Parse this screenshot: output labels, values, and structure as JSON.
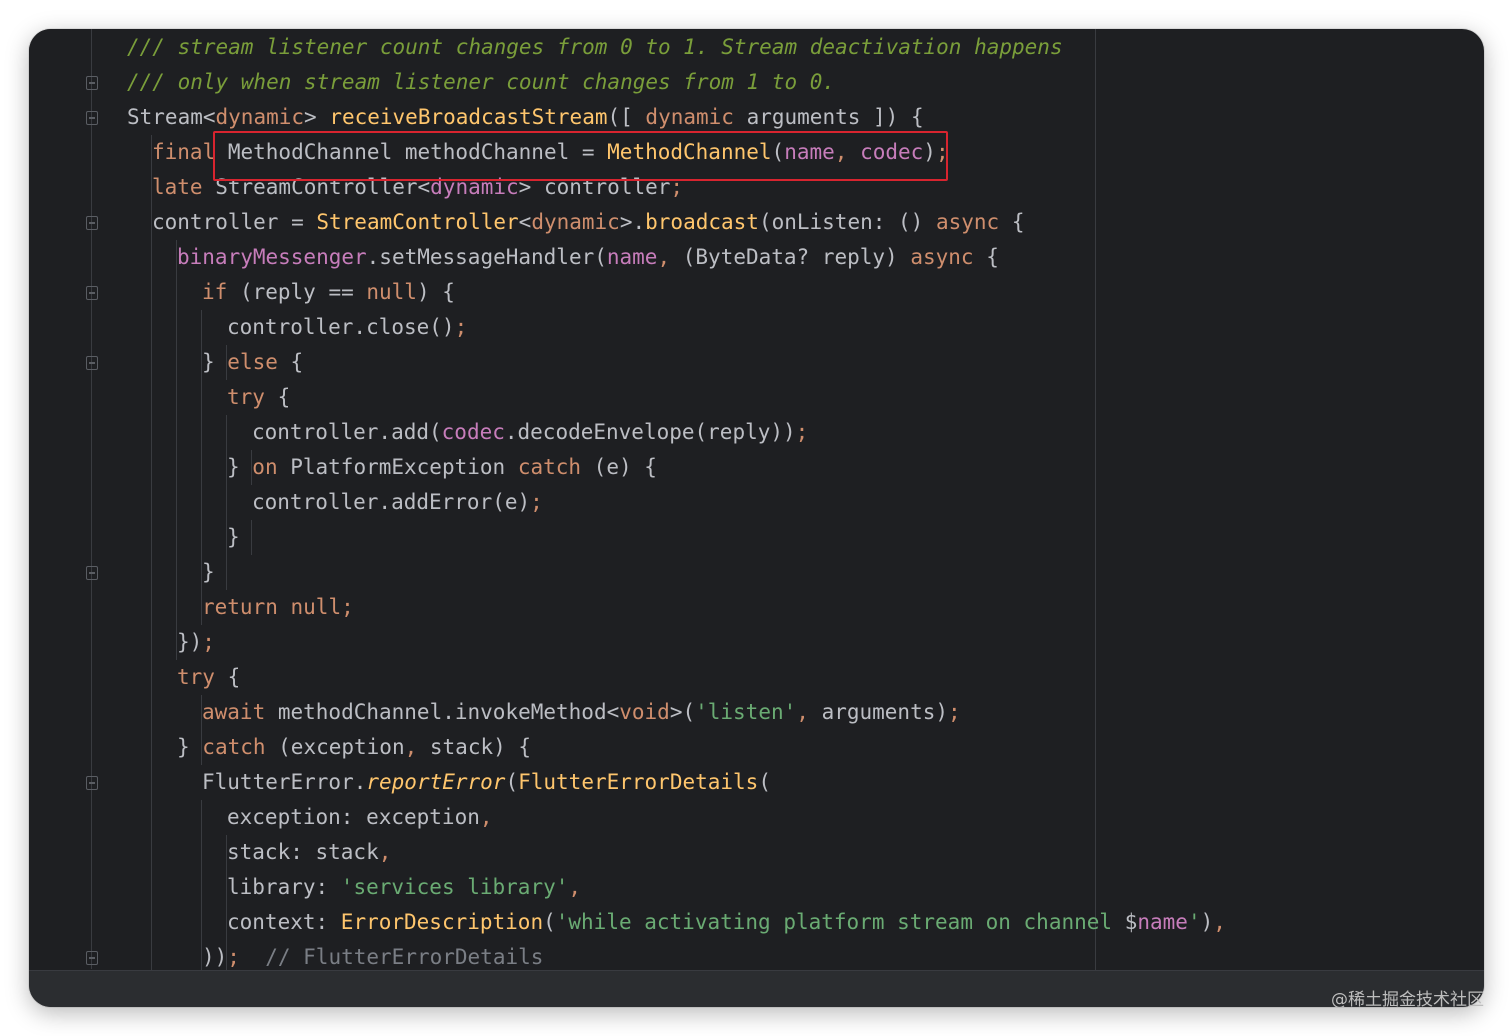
{
  "editor": {
    "language": "Dart",
    "theme_colors": {
      "background": "#1e1f22",
      "comment": "#7a9e3a",
      "keyword": "#cf8e6d",
      "function": "#ffc66d",
      "string": "#6aab73",
      "field": "#c77dbb",
      "text": "#bcbec4",
      "highlight_box": "#d8242f"
    },
    "lines": [
      {
        "indent": 0,
        "tokens": [
          {
            "t": "/// stream listener count changes from 0 to 1. Stream deactivation happens",
            "c": "cmt"
          }
        ]
      },
      {
        "indent": 0,
        "tokens": [
          {
            "t": "/// only when stream listener count changes from 1 to 0.",
            "c": "cmt"
          }
        ]
      },
      {
        "indent": 0,
        "tokens": [
          {
            "t": "Stream<",
            "c": "type"
          },
          {
            "t": "dynamic",
            "c": "kw"
          },
          {
            "t": "> ",
            "c": "type"
          },
          {
            "t": "receiveBroadcastStream",
            "c": "fn"
          },
          {
            "t": "([ ",
            "c": "type"
          },
          {
            "t": "dynamic",
            "c": "kw"
          },
          {
            "t": " arguments ]) {",
            "c": "type"
          }
        ]
      },
      {
        "indent": 1,
        "tokens": [
          {
            "t": "final",
            "c": "kw"
          },
          {
            "t": " MethodChannel methodChannel = ",
            "c": "type"
          },
          {
            "t": "MethodChannel",
            "c": "fn"
          },
          {
            "t": "(",
            "c": "type"
          },
          {
            "t": "name",
            "c": "field"
          },
          {
            "t": ", ",
            "c": "punc"
          },
          {
            "t": "codec",
            "c": "field"
          },
          {
            "t": ")",
            "c": "type"
          },
          {
            "t": ";",
            "c": "punc"
          }
        ]
      },
      {
        "indent": 1,
        "tokens": [
          {
            "t": "late",
            "c": "kw"
          },
          {
            "t": " StreamController<",
            "c": "type"
          },
          {
            "t": "dynamic",
            "c": "field"
          },
          {
            "t": "> controller",
            "c": "type"
          },
          {
            "t": ";",
            "c": "punc"
          }
        ]
      },
      {
        "indent": 1,
        "tokens": [
          {
            "t": "controller = ",
            "c": "type"
          },
          {
            "t": "StreamController",
            "c": "fn"
          },
          {
            "t": "<",
            "c": "type"
          },
          {
            "t": "dynamic",
            "c": "kw"
          },
          {
            "t": ">.",
            "c": "type"
          },
          {
            "t": "broadcast",
            "c": "fn"
          },
          {
            "t": "(onListen: () ",
            "c": "type"
          },
          {
            "t": "async",
            "c": "kw"
          },
          {
            "t": " {",
            "c": "type"
          }
        ]
      },
      {
        "indent": 2,
        "tokens": [
          {
            "t": "binaryMessenger",
            "c": "field"
          },
          {
            "t": ".setMessageHandler(",
            "c": "type"
          },
          {
            "t": "name",
            "c": "field"
          },
          {
            "t": ", ",
            "c": "punc"
          },
          {
            "t": "(ByteData? reply) ",
            "c": "type"
          },
          {
            "t": "async",
            "c": "kw"
          },
          {
            "t": " {",
            "c": "type"
          }
        ]
      },
      {
        "indent": 3,
        "tokens": [
          {
            "t": "if",
            "c": "kw"
          },
          {
            "t": " (reply == ",
            "c": "type"
          },
          {
            "t": "null",
            "c": "kw"
          },
          {
            "t": ") {",
            "c": "type"
          }
        ]
      },
      {
        "indent": 4,
        "tokens": [
          {
            "t": "controller.close()",
            "c": "type"
          },
          {
            "t": ";",
            "c": "punc"
          }
        ]
      },
      {
        "indent": 3,
        "tokens": [
          {
            "t": "} ",
            "c": "type"
          },
          {
            "t": "else",
            "c": "kw"
          },
          {
            "t": " {",
            "c": "type"
          }
        ]
      },
      {
        "indent": 4,
        "tokens": [
          {
            "t": "try",
            "c": "kw"
          },
          {
            "t": " {",
            "c": "type"
          }
        ]
      },
      {
        "indent": 5,
        "tokens": [
          {
            "t": "controller.add(",
            "c": "type"
          },
          {
            "t": "codec",
            "c": "field"
          },
          {
            "t": ".decodeEnvelope(reply))",
            "c": "type"
          },
          {
            "t": ";",
            "c": "punc"
          }
        ]
      },
      {
        "indent": 4,
        "tokens": [
          {
            "t": "} ",
            "c": "type"
          },
          {
            "t": "on",
            "c": "kw"
          },
          {
            "t": " PlatformException ",
            "c": "type"
          },
          {
            "t": "catch",
            "c": "kw"
          },
          {
            "t": " (e) {",
            "c": "type"
          }
        ]
      },
      {
        "indent": 5,
        "tokens": [
          {
            "t": "controller.addError(e)",
            "c": "type"
          },
          {
            "t": ";",
            "c": "punc"
          }
        ]
      },
      {
        "indent": 4,
        "tokens": [
          {
            "t": "}",
            "c": "type"
          }
        ]
      },
      {
        "indent": 3,
        "tokens": [
          {
            "t": "}",
            "c": "type"
          }
        ]
      },
      {
        "indent": 3,
        "tokens": [
          {
            "t": "return",
            "c": "kw"
          },
          {
            "t": " ",
            "c": "type"
          },
          {
            "t": "null",
            "c": "kw"
          },
          {
            "t": ";",
            "c": "punc"
          }
        ]
      },
      {
        "indent": 2,
        "tokens": [
          {
            "t": "})",
            "c": "type"
          },
          {
            "t": ";",
            "c": "punc"
          }
        ]
      },
      {
        "indent": 2,
        "tokens": [
          {
            "t": "try",
            "c": "kw"
          },
          {
            "t": " {",
            "c": "type"
          }
        ]
      },
      {
        "indent": 3,
        "tokens": [
          {
            "t": "await",
            "c": "kw"
          },
          {
            "t": " methodChannel.invokeMethod<",
            "c": "type"
          },
          {
            "t": "void",
            "c": "kw"
          },
          {
            "t": ">(",
            "c": "type"
          },
          {
            "t": "'listen'",
            "c": "str"
          },
          {
            "t": ", ",
            "c": "punc"
          },
          {
            "t": "arguments)",
            "c": "type"
          },
          {
            "t": ";",
            "c": "punc"
          }
        ]
      },
      {
        "indent": 2,
        "tokens": [
          {
            "t": "} ",
            "c": "type"
          },
          {
            "t": "catch",
            "c": "kw"
          },
          {
            "t": " (exception",
            "c": "type"
          },
          {
            "t": ", ",
            "c": "punc"
          },
          {
            "t": "stack) {",
            "c": "type"
          }
        ]
      },
      {
        "indent": 3,
        "tokens": [
          {
            "t": "FlutterError.",
            "c": "type"
          },
          {
            "t": "reportError",
            "c": "ital"
          },
          {
            "t": "(",
            "c": "type"
          },
          {
            "t": "FlutterErrorDetails",
            "c": "fn"
          },
          {
            "t": "(",
            "c": "type"
          }
        ]
      },
      {
        "indent": 4,
        "tokens": [
          {
            "t": "exception: exception",
            "c": "type"
          },
          {
            "t": ",",
            "c": "punc"
          }
        ]
      },
      {
        "indent": 4,
        "tokens": [
          {
            "t": "stack: stack",
            "c": "type"
          },
          {
            "t": ",",
            "c": "punc"
          }
        ]
      },
      {
        "indent": 4,
        "tokens": [
          {
            "t": "library: ",
            "c": "type"
          },
          {
            "t": "'services library'",
            "c": "str"
          },
          {
            "t": ",",
            "c": "punc"
          }
        ]
      },
      {
        "indent": 4,
        "tokens": [
          {
            "t": "context: ",
            "c": "type"
          },
          {
            "t": "ErrorDescription",
            "c": "fn"
          },
          {
            "t": "(",
            "c": "type"
          },
          {
            "t": "'while activating platform stream on channel ",
            "c": "str"
          },
          {
            "t": "$",
            "c": "type"
          },
          {
            "t": "name",
            "c": "field"
          },
          {
            "t": "'",
            "c": "str"
          },
          {
            "t": ")",
            "c": "type"
          },
          {
            "t": ",",
            "c": "punc"
          }
        ]
      },
      {
        "indent": 3,
        "tokens": [
          {
            "t": "))",
            "c": "type"
          },
          {
            "t": ";",
            "c": "punc"
          },
          {
            "t": "  // FlutterErrorDetails",
            "c": "cmtplain"
          }
        ]
      }
    ]
  },
  "watermark": "@稀土掘金技术社区"
}
